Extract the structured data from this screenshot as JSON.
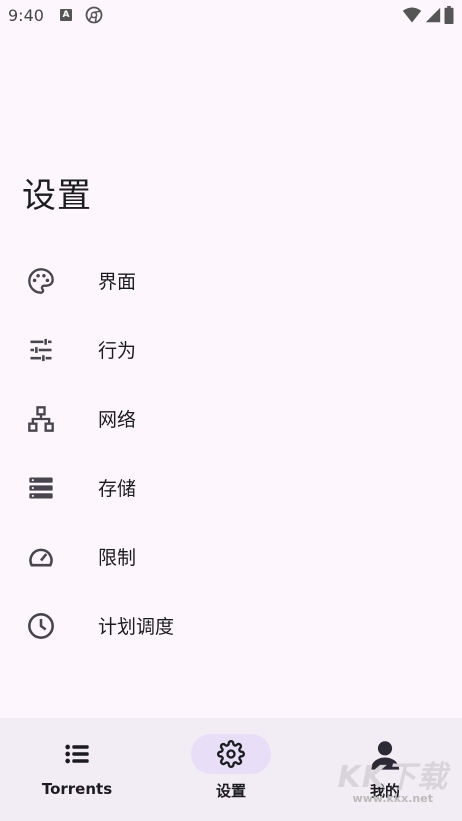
{
  "status_bar": {
    "time": "9:40",
    "icons": [
      "a-notification-icon",
      "chrome-icon",
      "wifi-icon",
      "signal-icon",
      "battery-icon"
    ]
  },
  "page": {
    "title": "设置"
  },
  "settings_items": [
    {
      "label": "界面",
      "icon": "palette-icon"
    },
    {
      "label": "行为",
      "icon": "tune-icon"
    },
    {
      "label": "网络",
      "icon": "network-icon"
    },
    {
      "label": "存储",
      "icon": "storage-icon"
    },
    {
      "label": "限制",
      "icon": "speed-icon"
    },
    {
      "label": "计划调度",
      "icon": "clock-icon"
    }
  ],
  "bottom_nav": [
    {
      "label": "Torrents",
      "icon": "list-icon",
      "active": false
    },
    {
      "label": "设置",
      "icon": "gear-icon",
      "active": true
    },
    {
      "label": "我的",
      "icon": "person-icon",
      "active": false
    }
  ],
  "watermark": {
    "text": "KK下载",
    "url": "www.kkx.net"
  },
  "colors": {
    "background": "#fdf7fd",
    "nav_background": "#f2ecf4",
    "active_pill": "#e8def8",
    "icon": "#49454f",
    "text": "#1c1b1f"
  }
}
